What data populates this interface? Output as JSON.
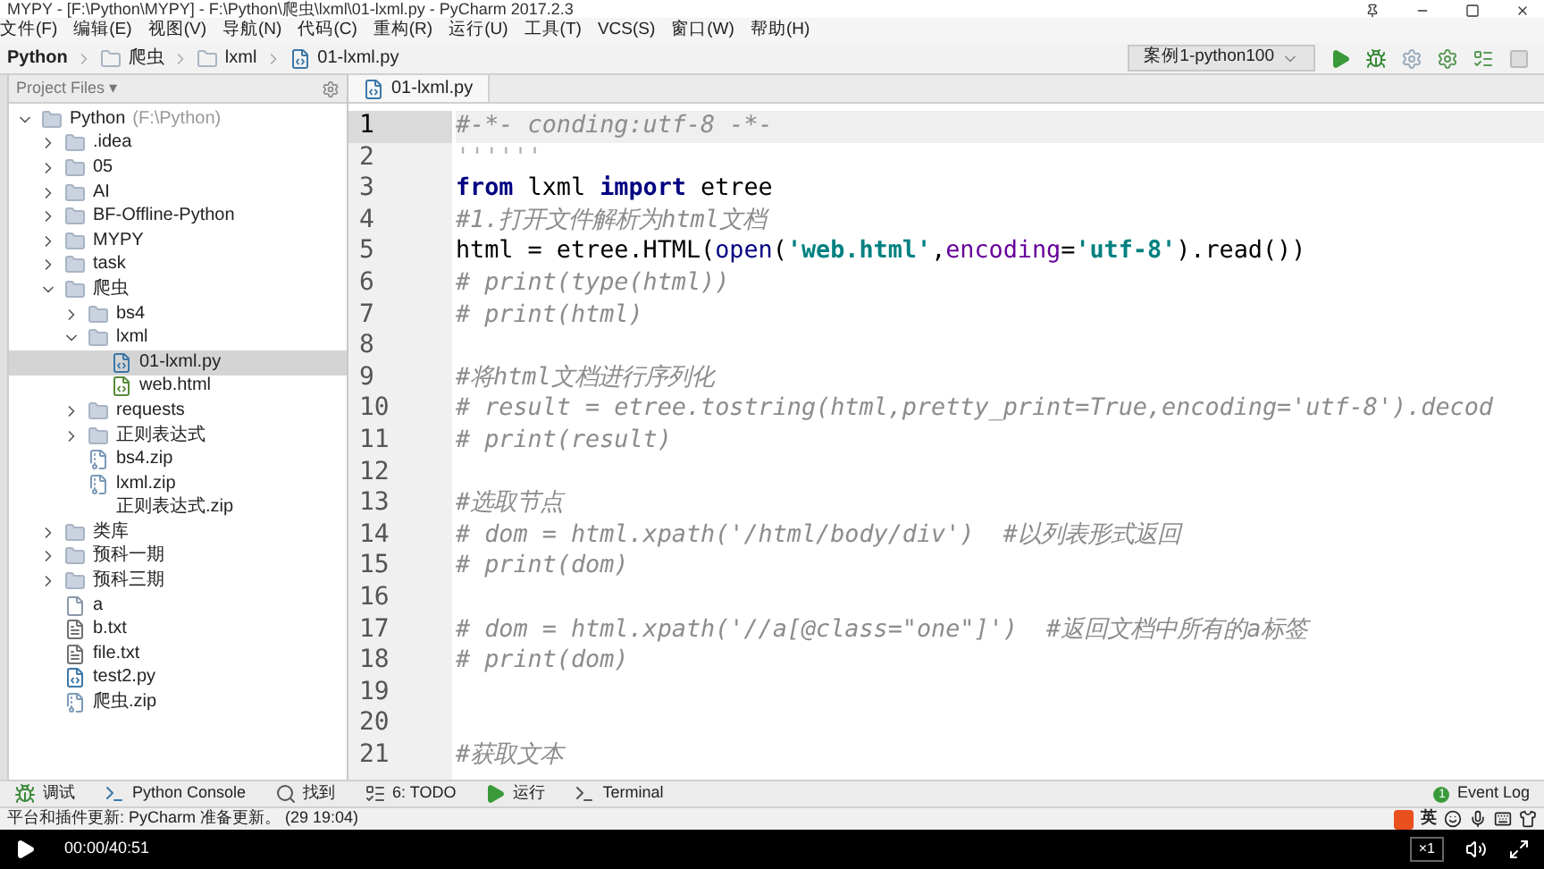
{
  "window": {
    "title": "MYPY - [F:\\Python\\MYPY] - F:\\Python\\爬虫\\lxml\\01-lxml.py - PyCharm 2017.2.3"
  },
  "menu": [
    "文件(F)",
    "编辑(E)",
    "视图(V)",
    "导航(N)",
    "代码(C)",
    "重构(R)",
    "运行(U)",
    "工具(T)",
    "VCS(S)",
    "窗口(W)",
    "帮助(H)"
  ],
  "breadcrumb": [
    {
      "label": "Python",
      "kind": "root"
    },
    {
      "label": "爬虫",
      "kind": "folder"
    },
    {
      "label": "lxml",
      "kind": "folder"
    },
    {
      "label": "01-lxml.py",
      "kind": "py"
    }
  ],
  "run_config": "案例1-python100",
  "project_panel": {
    "title": "Project Files ▾",
    "tree": [
      {
        "label": "Python",
        "note": "(F:\\Python)",
        "kind": "folder",
        "expanded": true,
        "selected": false,
        "children": [
          {
            "label": ".idea",
            "kind": "folder",
            "expanded": false,
            "selected": false
          },
          {
            "label": "05",
            "kind": "folder",
            "expanded": false,
            "selected": false
          },
          {
            "label": "AI",
            "kind": "folder",
            "expanded": false,
            "selected": false
          },
          {
            "label": "BF-Offline-Python",
            "kind": "folder",
            "expanded": false,
            "selected": false
          },
          {
            "label": "MYPY",
            "kind": "folder",
            "expanded": false,
            "selected": false
          },
          {
            "label": "task",
            "kind": "folder",
            "expanded": false,
            "selected": false
          },
          {
            "label": "爬虫",
            "kind": "folder",
            "expanded": true,
            "selected": false,
            "children": [
              {
                "label": "bs4",
                "kind": "folder",
                "expanded": false,
                "selected": false
              },
              {
                "label": "lxml",
                "kind": "folder",
                "expanded": true,
                "selected": false,
                "children": [
                  {
                    "label": "01-lxml.py",
                    "kind": "py",
                    "selected": true
                  },
                  {
                    "label": "web.html",
                    "kind": "html",
                    "selected": false
                  }
                ]
              },
              {
                "label": "requests",
                "kind": "folder",
                "expanded": false,
                "selected": false
              },
              {
                "label": "正则表达式",
                "kind": "folder",
                "expanded": false,
                "selected": false
              },
              {
                "label": "bs4.zip",
                "kind": "zip",
                "selected": false
              },
              {
                "label": "lxml.zip",
                "kind": "zip",
                "selected": false
              },
              {
                "label": "正则表达式.zip",
                "kind": "blank",
                "selected": false
              }
            ]
          },
          {
            "label": "类库",
            "kind": "folder",
            "expanded": false,
            "selected": false
          },
          {
            "label": "预科一期",
            "kind": "folder",
            "expanded": false,
            "selected": false
          },
          {
            "label": "预科三期",
            "kind": "folder",
            "expanded": false,
            "selected": false
          },
          {
            "label": "a",
            "kind": "file",
            "selected": false
          },
          {
            "label": "b.txt",
            "kind": "txt",
            "selected": false
          },
          {
            "label": "file.txt",
            "kind": "txt",
            "selected": false
          },
          {
            "label": "test2.py",
            "kind": "py",
            "selected": false
          },
          {
            "label": "爬虫.zip",
            "kind": "zip",
            "selected": false
          }
        ]
      }
    ]
  },
  "editor": {
    "tab": "01-lxml.py",
    "lines": [
      {
        "number": "1",
        "current": true,
        "tokens": [
          {
            "text": "#-*- conding:utf-8 -*-",
            "kind": "comment"
          }
        ]
      },
      {
        "number": "2",
        "current": false,
        "tokens": [
          {
            "text": "''''''",
            "kind": "docstring"
          }
        ]
      },
      {
        "number": "3",
        "current": false,
        "tokens": [
          {
            "text": "from",
            "kind": "keyword"
          },
          {
            "text": " lxml ",
            "kind": "plain"
          },
          {
            "text": "import",
            "kind": "keyword"
          },
          {
            "text": " etree",
            "kind": "plain"
          }
        ]
      },
      {
        "number": "4",
        "current": false,
        "tokens": [
          {
            "text": "#1.打开文件解析为html文档",
            "kind": "comment"
          }
        ]
      },
      {
        "number": "5",
        "current": false,
        "tokens": [
          {
            "text": "html = etree.HTML(",
            "kind": "plain"
          },
          {
            "text": "open",
            "kind": "builtin"
          },
          {
            "text": "(",
            "kind": "plain"
          },
          {
            "text": "'web.html'",
            "kind": "string"
          },
          {
            "text": ",",
            "kind": "plain"
          },
          {
            "text": "encoding",
            "kind": "param"
          },
          {
            "text": "=",
            "kind": "plain"
          },
          {
            "text": "'utf-8'",
            "kind": "string"
          },
          {
            "text": ").read())",
            "kind": "plain"
          }
        ]
      },
      {
        "number": "6",
        "current": false,
        "tokens": [
          {
            "text": "# print(type(html))",
            "kind": "comment"
          }
        ]
      },
      {
        "number": "7",
        "current": false,
        "tokens": [
          {
            "text": "# print(html)",
            "kind": "comment"
          }
        ]
      },
      {
        "number": "8",
        "current": false
      },
      {
        "number": "9",
        "current": false,
        "tokens": [
          {
            "text": "#将html文档进行序列化",
            "kind": "comment"
          }
        ]
      },
      {
        "number": "10",
        "current": false,
        "tokens": [
          {
            "text": "# result = etree.tostring(html,pretty_print=True,encoding='utf-8').decod",
            "kind": "comment"
          }
        ]
      },
      {
        "number": "11",
        "current": false,
        "tokens": [
          {
            "text": "# print(result)",
            "kind": "comment"
          }
        ]
      },
      {
        "number": "12",
        "current": false
      },
      {
        "number": "13",
        "current": false,
        "tokens": [
          {
            "text": "#选取节点",
            "kind": "comment"
          }
        ]
      },
      {
        "number": "14",
        "current": false,
        "tokens": [
          {
            "text": "# dom = html.xpath('/html/body/div')  #以列表形式返回",
            "kind": "comment"
          }
        ]
      },
      {
        "number": "15",
        "current": false,
        "tokens": [
          {
            "text": "# print(dom)",
            "kind": "comment"
          }
        ]
      },
      {
        "number": "16",
        "current": false
      },
      {
        "number": "17",
        "current": false,
        "tokens": [
          {
            "text": "# dom = html.xpath('//a[@class=\"one\"]')  #返回文档中所有的a标签",
            "kind": "comment"
          }
        ]
      },
      {
        "number": "18",
        "current": false,
        "tokens": [
          {
            "text": "# print(dom)",
            "kind": "comment"
          }
        ]
      },
      {
        "number": "19",
        "current": false
      },
      {
        "number": "20",
        "current": false
      },
      {
        "number": "21",
        "current": false,
        "tokens": [
          {
            "text": "#获取文本",
            "kind": "comment"
          }
        ]
      }
    ]
  },
  "tool_windows": [
    {
      "label": "调试",
      "kind": "debug"
    },
    {
      "label": "Python Console",
      "kind": "console"
    },
    {
      "label": "找到",
      "kind": "find"
    },
    {
      "label": "6: TODO",
      "kind": "todo"
    },
    {
      "label": "运行",
      "kind": "run"
    },
    {
      "label": "Terminal",
      "kind": "terminal"
    }
  ],
  "event_log": {
    "label": "Event Log",
    "badge": "1"
  },
  "status_bar": "平台和插件更新: PyCharm 准备更新。 (29 19:04)",
  "ime": {
    "label": "英"
  },
  "player": {
    "time": "00:00/40:51",
    "speed": "×1"
  }
}
